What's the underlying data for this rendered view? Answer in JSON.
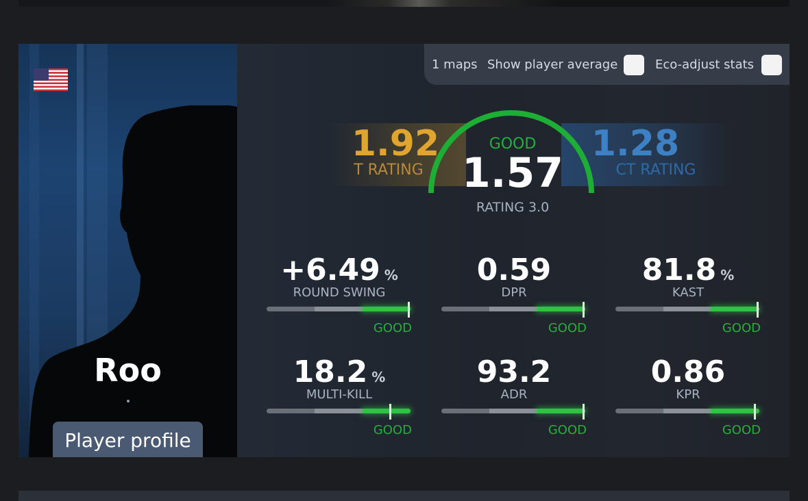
{
  "controls": {
    "maps": "1 maps",
    "show_avg": "Show player average",
    "eco": "Eco-adjust stats"
  },
  "player": {
    "name": "Roo",
    "profile_button": "Player profile",
    "flag_country": "United States"
  },
  "ratings": {
    "t_value": "1.92",
    "t_label": "T RATING",
    "ct_value": "1.28",
    "ct_label": "CT RATING",
    "main_value": "1.57",
    "main_quality": "GOOD",
    "main_label": "RATING 3.0"
  },
  "stats": [
    {
      "value": "+6.49",
      "unit": "%",
      "label": "ROUND SWING",
      "rating": "GOOD",
      "level": 0.98
    },
    {
      "value": "0.59",
      "unit": "",
      "label": "DPR",
      "rating": "GOOD",
      "level": 0.98
    },
    {
      "value": "81.8",
      "unit": "%",
      "label": "KAST",
      "rating": "GOOD",
      "level": 0.98
    },
    {
      "value": "18.2",
      "unit": "%",
      "label": "MULTI-KILL",
      "rating": "GOOD",
      "level": 0.85
    },
    {
      "value": "93.2",
      "unit": "",
      "label": "ADR",
      "rating": "GOOD",
      "level": 0.98
    },
    {
      "value": "0.86",
      "unit": "",
      "label": "KPR",
      "rating": "GOOD",
      "level": 0.96
    }
  ],
  "colors": {
    "good": "#23b13a",
    "t_side": "#e0a52f",
    "ct_side": "#3d80c4"
  }
}
